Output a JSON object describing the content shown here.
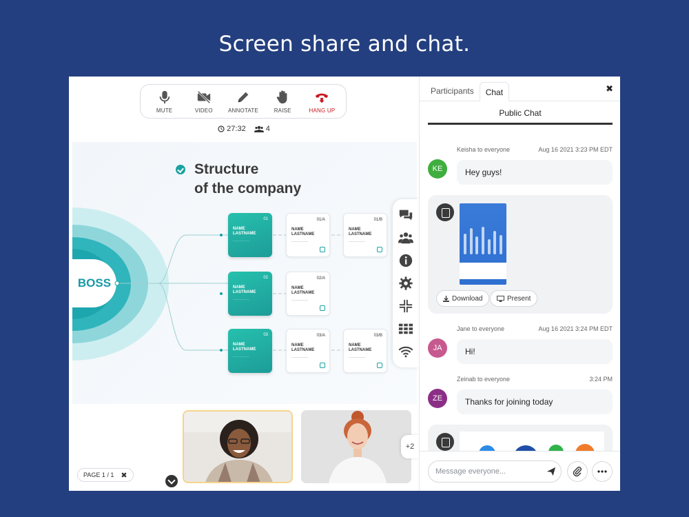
{
  "headline": "Screen share and chat.",
  "toolbar": {
    "mute": "MUTE",
    "video": "VIDEO",
    "annotate": "ANNOTATE",
    "raise": "RAISE",
    "hang_up": "HANG UP"
  },
  "meeting": {
    "time": "27:32",
    "participants": "4"
  },
  "slide": {
    "title_line1": "Structure",
    "title_line2": "of the company",
    "boss": "BOSS",
    "cards": [
      {
        "num": "01",
        "name1": "NAME",
        "name2": "LASTNAME"
      },
      {
        "num": "01/A",
        "name1": "NAME",
        "name2": "LASTNAME"
      },
      {
        "num": "01/B",
        "name1": "NAME",
        "name2": "LASTNAME"
      },
      {
        "num": "02",
        "name1": "NAME",
        "name2": "LASTNAME"
      },
      {
        "num": "02/A",
        "name1": "NAME",
        "name2": "LASTNAME"
      },
      {
        "num": "03",
        "name1": "NAME",
        "name2": "LASTNAME"
      },
      {
        "num": "03/A",
        "name1": "NAME",
        "name2": "LASTNAME"
      },
      {
        "num": "03/B",
        "name1": "NAME",
        "name2": "LASTNAME"
      }
    ]
  },
  "extra_participants": "+2",
  "page_indicator": "PAGE 1 / 1",
  "chat": {
    "tabs": [
      "Participants",
      "Chat"
    ],
    "active_tab": "Chat",
    "title": "Public Chat",
    "messages": [
      {
        "header": "Keisha to everyone",
        "time": "Aug 16 2021 3:23 PM EDT",
        "initials": "KE",
        "color": "#3fae3f",
        "text": "Hey guys!"
      },
      {
        "header": "Jane to everyone",
        "time": "Aug 16 2021 3:24 PM EDT",
        "initials": "JA",
        "color": "#c65a8e",
        "text": "Hi!"
      },
      {
        "header": "Zeinab to everyone",
        "time": "3:24 PM",
        "initials": "ZE",
        "color": "#8b2f86",
        "text": "Thanks for joining today"
      }
    ],
    "file": {
      "download": "Download",
      "present": "Present"
    },
    "input_placeholder": "Message everyone..."
  }
}
